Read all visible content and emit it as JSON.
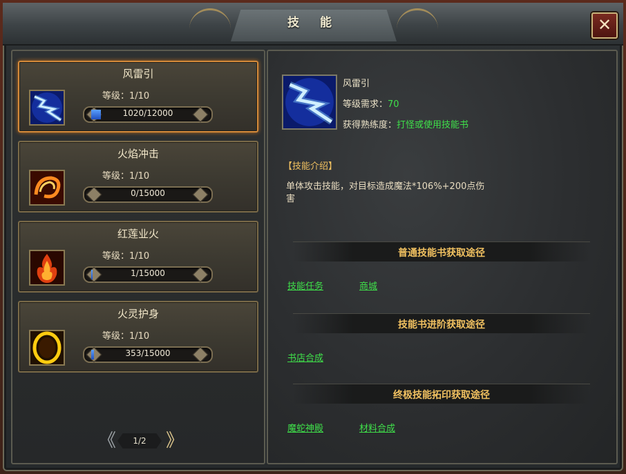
{
  "window": {
    "title": "技 能",
    "close_label": "✕"
  },
  "skills": [
    {
      "name": "风雷引",
      "level": "等级：1/10",
      "progress_text": "1020/12000",
      "progress": 0.085,
      "icon": "lightning-icon"
    },
    {
      "name": "火焰冲击",
      "level": "等级：1/10",
      "progress_text": "0/15000",
      "progress": 0.0,
      "icon": "fire-swirl-icon"
    },
    {
      "name": "红莲业火",
      "level": "等级：1/10",
      "progress_text": "1/15000",
      "progress": 0.0001,
      "icon": "flame-burst-icon"
    },
    {
      "name": "火灵护身",
      "level": "等级：1/10",
      "progress_text": "353/15000",
      "progress": 0.0235,
      "icon": "fire-ring-icon"
    }
  ],
  "pager": {
    "text": "1/2",
    "prev": "《",
    "next": "》"
  },
  "detail": {
    "name": "风雷引",
    "req_label": "等级需求：",
    "req_value": "70",
    "exp_label": "获得熟练度：",
    "exp_value": "打怪或使用技能书",
    "intro_title": "【技能介绍】",
    "intro_text": "单体攻击技能，对目标造成魔法*106%+200点伤害",
    "sections": [
      {
        "title": "普通技能书获取途径",
        "links": [
          "技能任务",
          "商城"
        ]
      },
      {
        "title": "技能书进阶获取途径",
        "links": [
          "书店合成"
        ]
      },
      {
        "title": "终极技能拓印获取途径",
        "links": [
          "魔蛇神殿",
          "材料合成"
        ]
      }
    ]
  }
}
